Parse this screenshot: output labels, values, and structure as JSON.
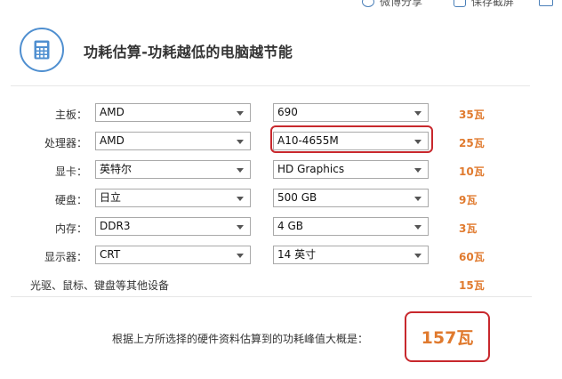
{
  "toolbar": {
    "share_label": "微博分享",
    "screenshot_label": "保存截屏"
  },
  "header": {
    "icon": "calculator-icon",
    "title": "功耗估算-功耗越低的电脑越节能"
  },
  "rows": [
    {
      "label": "主板：",
      "select_a": "AMD",
      "select_b": "690",
      "power": "35瓦"
    },
    {
      "label": "处理器：",
      "select_a": "AMD",
      "select_b": "A10-4655M",
      "power": "25瓦"
    },
    {
      "label": "显卡：",
      "select_a": "英特尔",
      "select_b": "HD Graphics",
      "power": "10瓦"
    },
    {
      "label": "硬盘：",
      "select_a": "日立",
      "select_b": "500 GB",
      "power": "9瓦"
    },
    {
      "label": "内存：",
      "select_a": "DDR3",
      "select_b": "4 GB",
      "power": "3瓦"
    },
    {
      "label": "显示器：",
      "select_a": "CRT",
      "select_b": "14 英寸",
      "power": "60瓦"
    }
  ],
  "other_devices": {
    "label": "光驱、鼠标、键盘等其他设备",
    "power": "15瓦"
  },
  "summary": {
    "label": "根据上方所选择的硬件资料估算到的功耗峰值大概是：",
    "total": "157瓦"
  },
  "colors": {
    "accent_orange": "#e07a2e",
    "highlight_red": "#c8282d",
    "icon_blue": "#4f8fd0"
  }
}
